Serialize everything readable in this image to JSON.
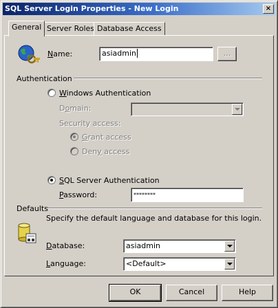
{
  "window": {
    "title": "SQL Server Login Properties - New Login",
    "close_glyph": "×"
  },
  "tabs": [
    {
      "label": "General",
      "active": true
    },
    {
      "label": "Server Roles",
      "active": false
    },
    {
      "label": "Database Access",
      "active": false
    }
  ],
  "general": {
    "name_label": "Name:",
    "name_value": "asiadmin",
    "browse_label": "...",
    "auth_section": "Authentication",
    "windows_auth_label": "Windows Authentication",
    "domain_label": "Domain:",
    "domain_value": "",
    "security_access_label": "Security access:",
    "grant_access_label": "Grant access",
    "deny_access_label": "Deny access",
    "sql_auth_label": "SQL Server Authentication",
    "password_label": "Password:",
    "password_value": "********",
    "selected_auth": "SQL Server Authentication",
    "selected_security_access": "Grant access",
    "defaults_section": "Defaults",
    "defaults_description": "Specify the default language and database for this login.",
    "database_label": "Database:",
    "database_value": "asiadmin",
    "language_label": "Language:",
    "language_value": "<Default>"
  },
  "buttons": {
    "ok": "OK",
    "cancel": "Cancel",
    "help": "Help"
  },
  "icons": {
    "login": "globe-key-icon",
    "defaults": "database-icon"
  }
}
